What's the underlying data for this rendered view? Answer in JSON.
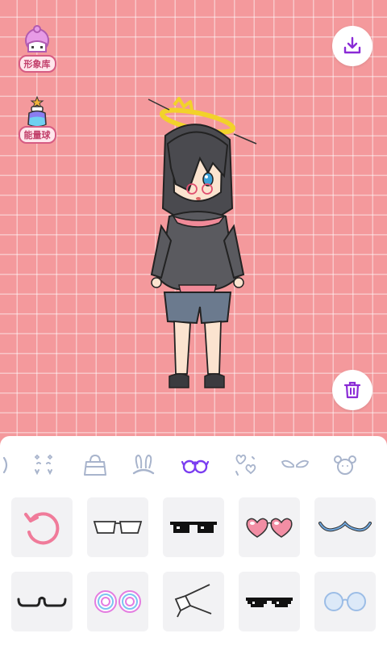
{
  "side_buttons": {
    "avatar_library_label": "形象库",
    "energy_ball_label": "能量球"
  },
  "toolbar": {
    "download_icon": "download-icon",
    "trash_icon": "trash-icon"
  },
  "categories": [
    {
      "name": "partial-category",
      "icon": "arc-icon"
    },
    {
      "name": "face-decoration",
      "icon": "sparkle-decoration-icon"
    },
    {
      "name": "bag",
      "icon": "handbag-icon"
    },
    {
      "name": "bunny-ears",
      "icon": "bunny-ears-icon"
    },
    {
      "name": "glasses",
      "icon": "glasses-icon",
      "selected": true
    },
    {
      "name": "hearts",
      "icon": "hearts-icon"
    },
    {
      "name": "wings",
      "icon": "wings-icon"
    },
    {
      "name": "bear-ears",
      "icon": "bear-ears-icon"
    }
  ],
  "items": [
    "reset",
    "rimless-glasses",
    "pixel-sunglasses",
    "heart-sunglasses",
    "wave-glasses",
    "half-rim-glasses",
    "swirl-glasses",
    "monocle-frame",
    "pixel-shades",
    "round-blue-glasses"
  ],
  "colors": {
    "background": "#f4999c",
    "accent_selected": "#7a3cf0",
    "icon_gray": "#a8b4cc",
    "reset_pink": "#f07b9a"
  }
}
